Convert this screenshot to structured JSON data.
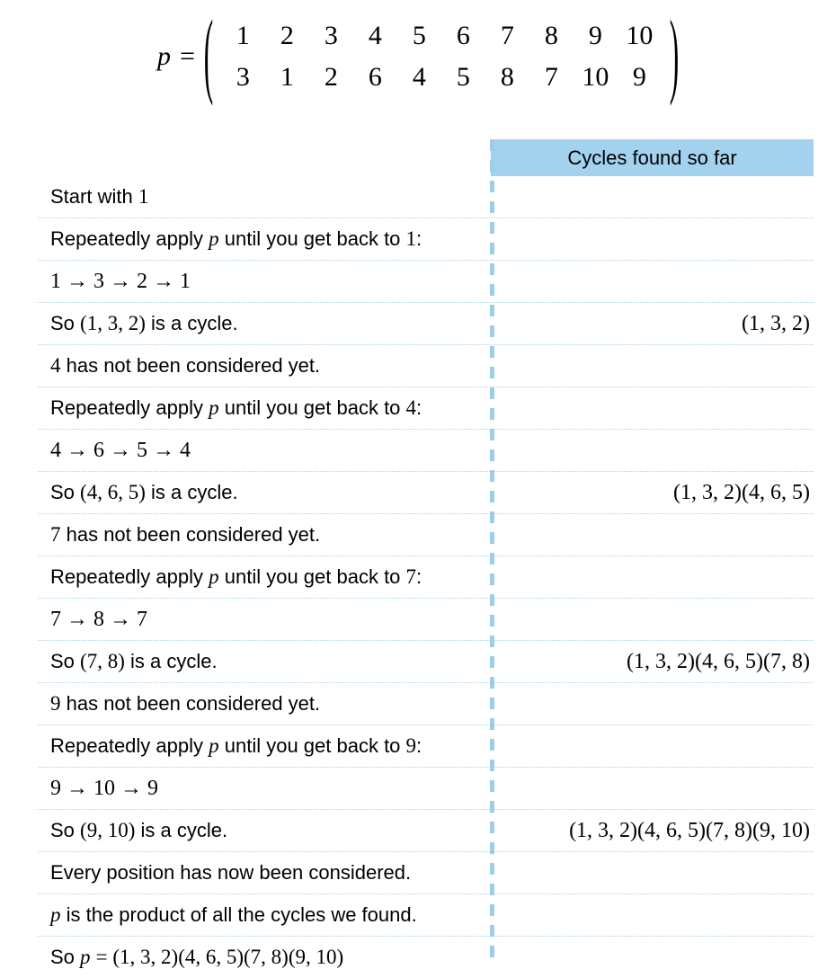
{
  "formula": {
    "symbol": "p",
    "equals": "=",
    "paren_left": "(",
    "paren_right": ")",
    "top_row": [
      "1",
      "2",
      "3",
      "4",
      "5",
      "6",
      "7",
      "8",
      "9",
      "10"
    ],
    "bottom_row": [
      "3",
      "1",
      "2",
      "6",
      "4",
      "5",
      "8",
      "7",
      "10",
      "9"
    ]
  },
  "table": {
    "header_right": "Cycles found so far",
    "header_bg": "#a3d2ef",
    "divider_color": "#9ecdec",
    "rule_color": "#a9d3ee",
    "rows": [
      {
        "left_plain": "Start with 1",
        "left_html": "Start with <span class=\"mn\">1</span>",
        "right": ""
      },
      {
        "left_plain": "Repeatedly apply p until you get back to 1:",
        "left_html": "Repeatedly apply <span class=\"mi\">p</span> until you get back to <span class=\"mn\">1</span>:",
        "right": ""
      },
      {
        "left_plain": "1 → 3 → 2 → 1",
        "left_html": "1 &#8594; 3 &#8594; 2 &#8594; 1",
        "math": true,
        "right": ""
      },
      {
        "left_plain": "So (1, 3, 2) is a cycle.",
        "left_html": "So <span class=\"mn\">(1, 3, 2)</span> is a cycle.",
        "right": "(1, 3, 2)"
      },
      {
        "left_plain": "4 has not been considered yet.",
        "left_html": "<span class=\"mn\">4</span> has not been considered yet.",
        "right": ""
      },
      {
        "left_plain": "Repeatedly apply p until you get back to 4:",
        "left_html": "Repeatedly apply <span class=\"mi\">p</span> until you get back to <span class=\"mn\">4</span>:",
        "right": ""
      },
      {
        "left_plain": "4 → 6 → 5 → 4",
        "left_html": "4 &#8594; 6 &#8594; 5 &#8594; 4",
        "math": true,
        "right": ""
      },
      {
        "left_plain": "So (4, 6, 5) is a cycle.",
        "left_html": "So <span class=\"mn\">(4, 6, 5)</span> is a cycle.",
        "right": "(1, 3, 2)(4, 6, 5)"
      },
      {
        "left_plain": "7 has not been considered yet.",
        "left_html": "<span class=\"mn\">7</span> has not been considered yet.",
        "right": ""
      },
      {
        "left_plain": "Repeatedly apply p until you get back to 7:",
        "left_html": "Repeatedly apply <span class=\"mi\">p</span> until you get back to <span class=\"mn\">7</span>:",
        "right": ""
      },
      {
        "left_plain": "7 → 8 → 7",
        "left_html": "7 &#8594; 8 &#8594; 7",
        "math": true,
        "right": ""
      },
      {
        "left_plain": "So (7, 8) is a cycle.",
        "left_html": "So <span class=\"mn\">(7, 8)</span> is a cycle.",
        "right": "(1, 3, 2)(4, 6, 5)(7, 8)"
      },
      {
        "left_plain": "9 has not been considered yet.",
        "left_html": "<span class=\"mn\">9</span> has not been considered yet.",
        "right": ""
      },
      {
        "left_plain": "Repeatedly apply p until you get back to 9:",
        "left_html": "Repeatedly apply <span class=\"mi\">p</span> until you get back to <span class=\"mn\">9</span>:",
        "right": ""
      },
      {
        "left_plain": "9 → 10 → 9",
        "left_html": "9 &#8594; 10 &#8594; 9",
        "math": true,
        "right": ""
      },
      {
        "left_plain": "So (9, 10) is a cycle.",
        "left_html": "So <span class=\"mn\">(9, 10)</span> is a cycle.",
        "right": "(1, 3, 2)(4, 6, 5)(7, 8)(9, 10)"
      },
      {
        "left_plain": "Every position has now been considered.",
        "left_html": "Every position has now been considered.",
        "right": ""
      },
      {
        "left_plain": "p is the product of all the cycles we found.",
        "left_html": "<span class=\"mi\">p</span> is the product of all the cycles we found.",
        "right": ""
      },
      {
        "left_plain": "So p = (1, 3, 2)(4, 6, 5)(7, 8)(9, 10)",
        "left_html": "So <span class=\"mi\">p</span> <span class=\"mn\">= (1, 3, 2)(4, 6, 5)(7, 8)(9, 10)</span>",
        "right": ""
      }
    ]
  }
}
